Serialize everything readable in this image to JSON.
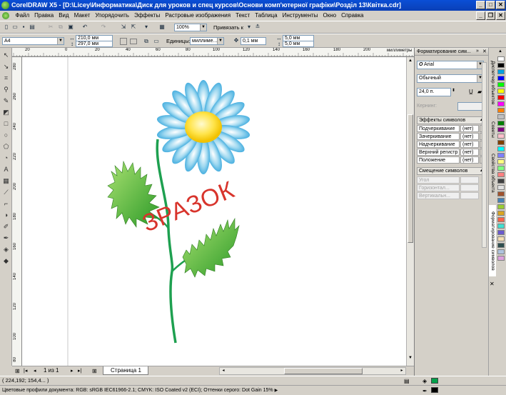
{
  "window": {
    "title": "CorelDRAW X5 - [D:\\Licey\\Информатика\\Диск для уроков и спец курсов\\Основи комп'ютерної графіки\\Розділ 13\\Квітка.cdr]",
    "minimize": "_",
    "maximize": "□",
    "close": "✕"
  },
  "menu": [
    "Файл",
    "Правка",
    "Вид",
    "Макет",
    "Упорядочить",
    "Эффекты",
    "Растровые изображения",
    "Текст",
    "Таблица",
    "Инструменты",
    "Окно",
    "Справка"
  ],
  "standard_toolbar": {
    "zoom": "100%",
    "snap_label": "Привязать к"
  },
  "property_bar": {
    "page_size": "A4",
    "width": "210,0 мм",
    "height": "297,0 мм",
    "units_label": "Единицы:",
    "units_value": "миллиме...",
    "nudge": "0,1 мм",
    "dup_x": "5,0 мм",
    "dup_y": "5,0 мм"
  },
  "ruler": {
    "units": "миллиметры",
    "h_ticks": [
      "20",
      "0",
      "20",
      "40",
      "60",
      "80",
      "100",
      "120",
      "140",
      "160",
      "180",
      "200"
    ],
    "v_ticks": [
      "280",
      "260",
      "240",
      "220",
      "200",
      "180",
      "160",
      "140",
      "120",
      "100",
      "80"
    ]
  },
  "canvas": {
    "watermark": "ЗРАЗОК"
  },
  "docker": {
    "title": "Форматирование сим...",
    "font": "Arial",
    "style": "Обычный",
    "size": "24,0 п.",
    "kerning_label": "Кернинг:",
    "effects_header": "Эффекты символов",
    "effects": [
      {
        "name": "Подчеркивание",
        "value": "(нет)"
      },
      {
        "name": "Зачеркивание",
        "value": "(нет)"
      },
      {
        "name": "Надчеркивание",
        "value": "(нет)"
      },
      {
        "name": "Верхний регистр",
        "value": "(нет)"
      },
      {
        "name": "Положение",
        "value": "(нет)"
      }
    ],
    "shift_header": "Смещение символов",
    "shift": [
      "Угол",
      "Горизонтал...",
      "Вертикальн..."
    ]
  },
  "side_tabs": [
    "Диспетчер объектов",
    "Советы",
    "Свойства объекта",
    "Форматирование символов"
  ],
  "palette_colors": [
    "#ffffff",
    "#000000",
    "#00a0e0",
    "#0000ff",
    "#00ff00",
    "#ffff00",
    "#ff0000",
    "#ff00ff",
    "#ff8000",
    "#c0c0c0",
    "#008000",
    "#800080",
    "#ffc0cb",
    "#804000",
    "#00ffff",
    "#8080ff",
    "#ffff80",
    "#80ff80",
    "#ff8080",
    "#404040",
    "#e0e0e0",
    "#a0522d",
    "#4682b4",
    "#9acd32",
    "#daa520",
    "#ff6347",
    "#40e0d0",
    "#6a5acd",
    "#f5deb3",
    "#2f4f4f",
    "#b0c4de",
    "#dda0dd"
  ],
  "page_nav": {
    "counter": "1 из 1",
    "tab": "Страница 1"
  },
  "status": {
    "coords": "( 224,192; 154,4... )",
    "color_profiles": "Цветовые профили документа: RGB: sRGB IEC61966-2.1; CMYK: ISO Coated v2 (ECI); Оттенки серого: Dot Gain 15%"
  }
}
